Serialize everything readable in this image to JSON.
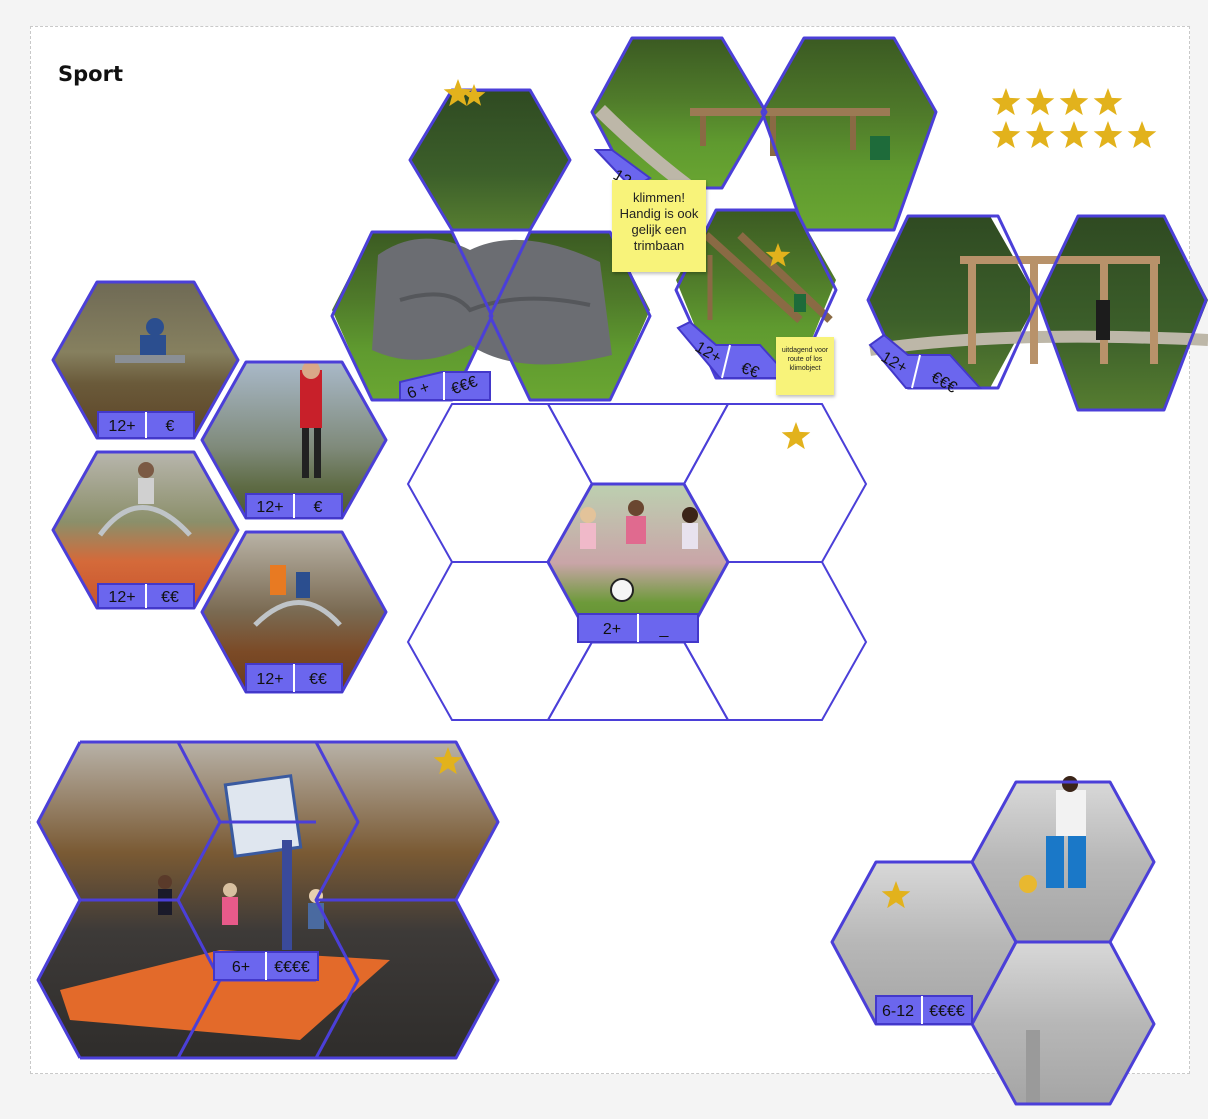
{
  "board": {
    "title": "Sport"
  },
  "notes": {
    "climb": "klimmen! Handig is ook gelijk een trimbaan",
    "route": "uitdagend voor route of los klimobject"
  },
  "tags": {
    "seat_top": {
      "age": "12+",
      "price": "€"
    },
    "bars": {
      "age": "12+",
      "price": "€"
    },
    "walker": {
      "age": "12+",
      "price": "€€"
    },
    "step": {
      "age": "12+",
      "price": "€€"
    },
    "rock": {
      "age": "6 +",
      "price": "€€€"
    },
    "balance": {
      "age": "12+",
      "price": ""
    },
    "climb_frame": {
      "age": "12+",
      "price": "€€"
    },
    "monkey_bars": {
      "age": "12+",
      "price": "€€€"
    },
    "kids_soccer": {
      "age": "2+",
      "price": "_"
    },
    "basketball": {
      "age": "6+",
      "price": "€€€€"
    },
    "soccer_cage": {
      "age": "6-12",
      "price": "€€€€"
    }
  },
  "ratings": {
    "row1_stars": 4,
    "row2_stars": 5
  },
  "colors": {
    "hex_outline": "#4b3fd8",
    "tag_fill": "#6b66ee",
    "star": "#e2b21c",
    "note": "#f8f37a"
  }
}
